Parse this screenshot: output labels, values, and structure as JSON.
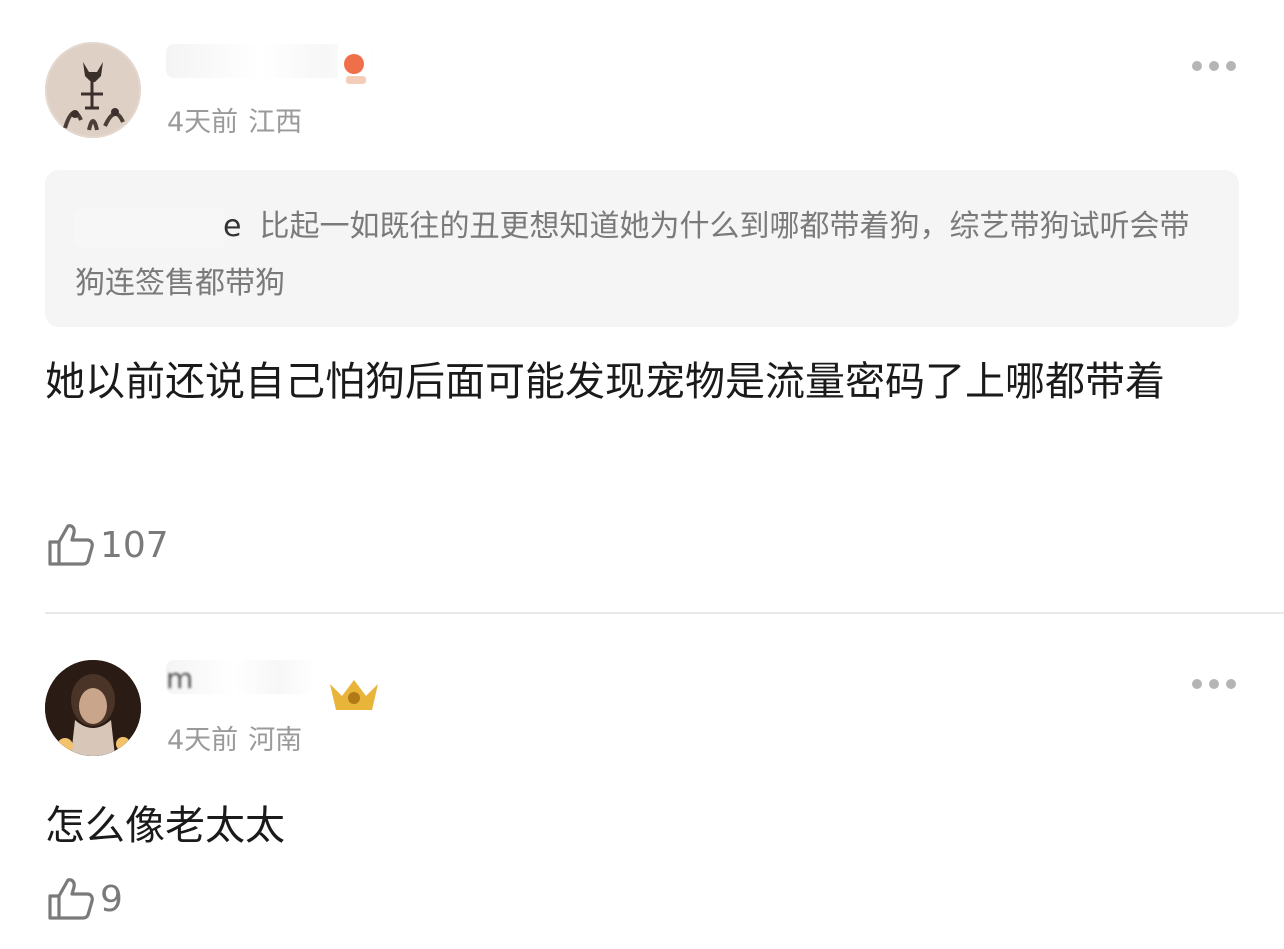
{
  "comments": [
    {
      "username_partial": "",
      "time": "4天前",
      "location": "江西",
      "quote": {
        "user_partial": "e",
        "text": "比起一如既往的丑更想知道她为什么到哪都带着狗，综艺带狗试听会带狗连签售都带狗"
      },
      "content": "她以前还说自己怕狗后面可能发现宠物是流量密码了上哪都带着",
      "likes": "107"
    },
    {
      "username_partial": "m",
      "time": "4天前",
      "location": "河南",
      "content": "怎么像老太太",
      "likes": "9"
    }
  ],
  "icons": {
    "more": "more-dots-icon",
    "like": "thumbs-up-icon"
  },
  "colors": {
    "meta": "#9a9a9a",
    "quote_bg": "#f5f5f5",
    "text": "#1a1a1a"
  }
}
